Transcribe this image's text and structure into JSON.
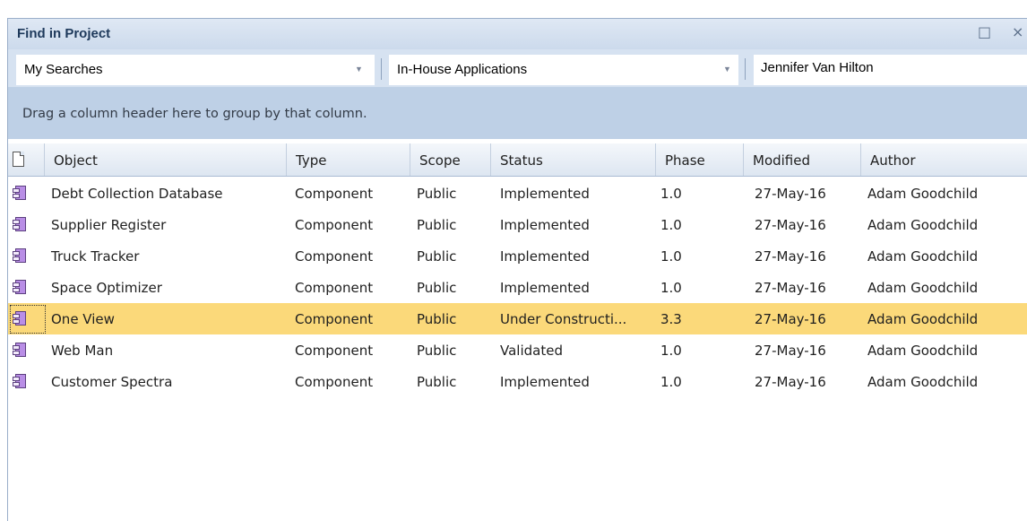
{
  "window": {
    "title": "Find in Project",
    "maximize_icon": "□",
    "close_icon": "×"
  },
  "toolbar": {
    "search_select": {
      "value": "My Searches",
      "arrow": "▼"
    },
    "package_select": {
      "value": "In-House Applications",
      "arrow": "▼"
    },
    "search_text": "Jennifer Van Hilton"
  },
  "group_area": {
    "hint": "Drag a column header here to group by that column."
  },
  "table": {
    "columns": [
      "Object",
      "Type",
      "Scope",
      "Status",
      "Phase",
      "Modified",
      "Author"
    ],
    "rows": [
      {
        "object": "Debt Collection Database",
        "type": "Component",
        "scope": "Public",
        "status": "Implemented",
        "phase": "1.0",
        "modified": "27-May-16",
        "author": "Adam Goodchild"
      },
      {
        "object": "Supplier Register",
        "type": "Component",
        "scope": "Public",
        "status": "Implemented",
        "phase": "1.0",
        "modified": "27-May-16",
        "author": "Adam Goodchild"
      },
      {
        "object": "Truck Tracker",
        "type": "Component",
        "scope": "Public",
        "status": "Implemented",
        "phase": "1.0",
        "modified": "27-May-16",
        "author": "Adam Goodchild"
      },
      {
        "object": "Space Optimizer",
        "type": "Component",
        "scope": "Public",
        "status": "Implemented",
        "phase": "1.0",
        "modified": "27-May-16",
        "author": "Adam Goodchild"
      },
      {
        "object": "One View",
        "type": "Component",
        "scope": "Public",
        "status": "Under Constructi...",
        "phase": "3.3",
        "modified": "27-May-16",
        "author": "Adam Goodchild"
      },
      {
        "object": "Web Man",
        "type": "Component",
        "scope": "Public",
        "status": "Validated",
        "phase": "1.0",
        "modified": "27-May-16",
        "author": "Adam Goodchild"
      },
      {
        "object": "Customer Spectra",
        "type": "Component",
        "scope": "Public",
        "status": "Implemented",
        "phase": "1.0",
        "modified": "27-May-16",
        "author": "Adam Goodchild"
      }
    ],
    "selected_row_index": 4,
    "selection_color": "#fbd97a",
    "row_icon": "component-icon"
  }
}
